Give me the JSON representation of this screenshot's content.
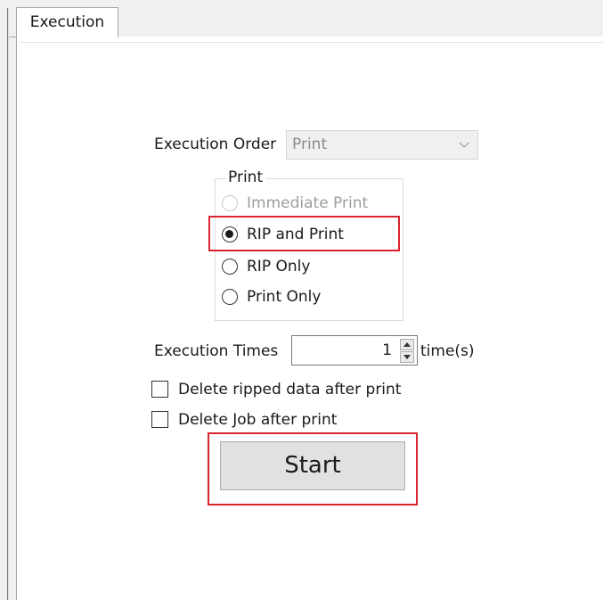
{
  "tabs": [
    {
      "label": "Execution",
      "active": true
    }
  ],
  "execution_order": {
    "label": "Execution Order",
    "selected": "Print",
    "enabled": false
  },
  "print_group": {
    "title": "Print",
    "options": [
      {
        "label": "Immediate Print",
        "selected": false,
        "enabled": false
      },
      {
        "label": "RIP and Print",
        "selected": true,
        "enabled": true
      },
      {
        "label": "RIP Only",
        "selected": false,
        "enabled": true
      },
      {
        "label": "Print Only",
        "selected": false,
        "enabled": true
      }
    ]
  },
  "execution_times": {
    "label": "Execution Times",
    "value": "1",
    "unit": "time(s)"
  },
  "checkboxes": [
    {
      "label": "Delete ripped data after print",
      "checked": false
    },
    {
      "label": "Delete Job after print",
      "checked": false
    }
  ],
  "start_button": {
    "label": "Start"
  },
  "colors": {
    "highlight": "#d9232e",
    "window_bg": "#f0f0f0",
    "panel_bg": "#ffffff"
  },
  "highlighted_elements": [
    "radio-rip-and-print",
    "start-button"
  ]
}
